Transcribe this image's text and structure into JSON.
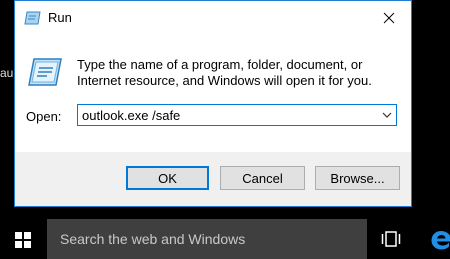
{
  "background": {
    "partial_text": "au"
  },
  "dialog": {
    "title": "Run",
    "icon": "run-icon",
    "close_icon": "close-icon",
    "description": "Type the name of a program, folder, document, or Internet resource, and Windows will open it for you.",
    "open_label": "Open:",
    "open_value": "outlook.exe /safe",
    "buttons": {
      "ok": "OK",
      "cancel": "Cancel",
      "browse": "Browse..."
    }
  },
  "taskbar": {
    "start_icon": "windows-logo-icon",
    "search_placeholder": "Search the web and Windows",
    "task_view_icon": "task-view-icon",
    "edge_icon": "edge-icon"
  },
  "colors": {
    "accent": "#0078d7",
    "dialog_border": "#1e7ed4",
    "button_bg": "#e1e1e1",
    "taskbar_search_bg": "#3f3f3f",
    "edge_blue": "#1e90e8"
  }
}
